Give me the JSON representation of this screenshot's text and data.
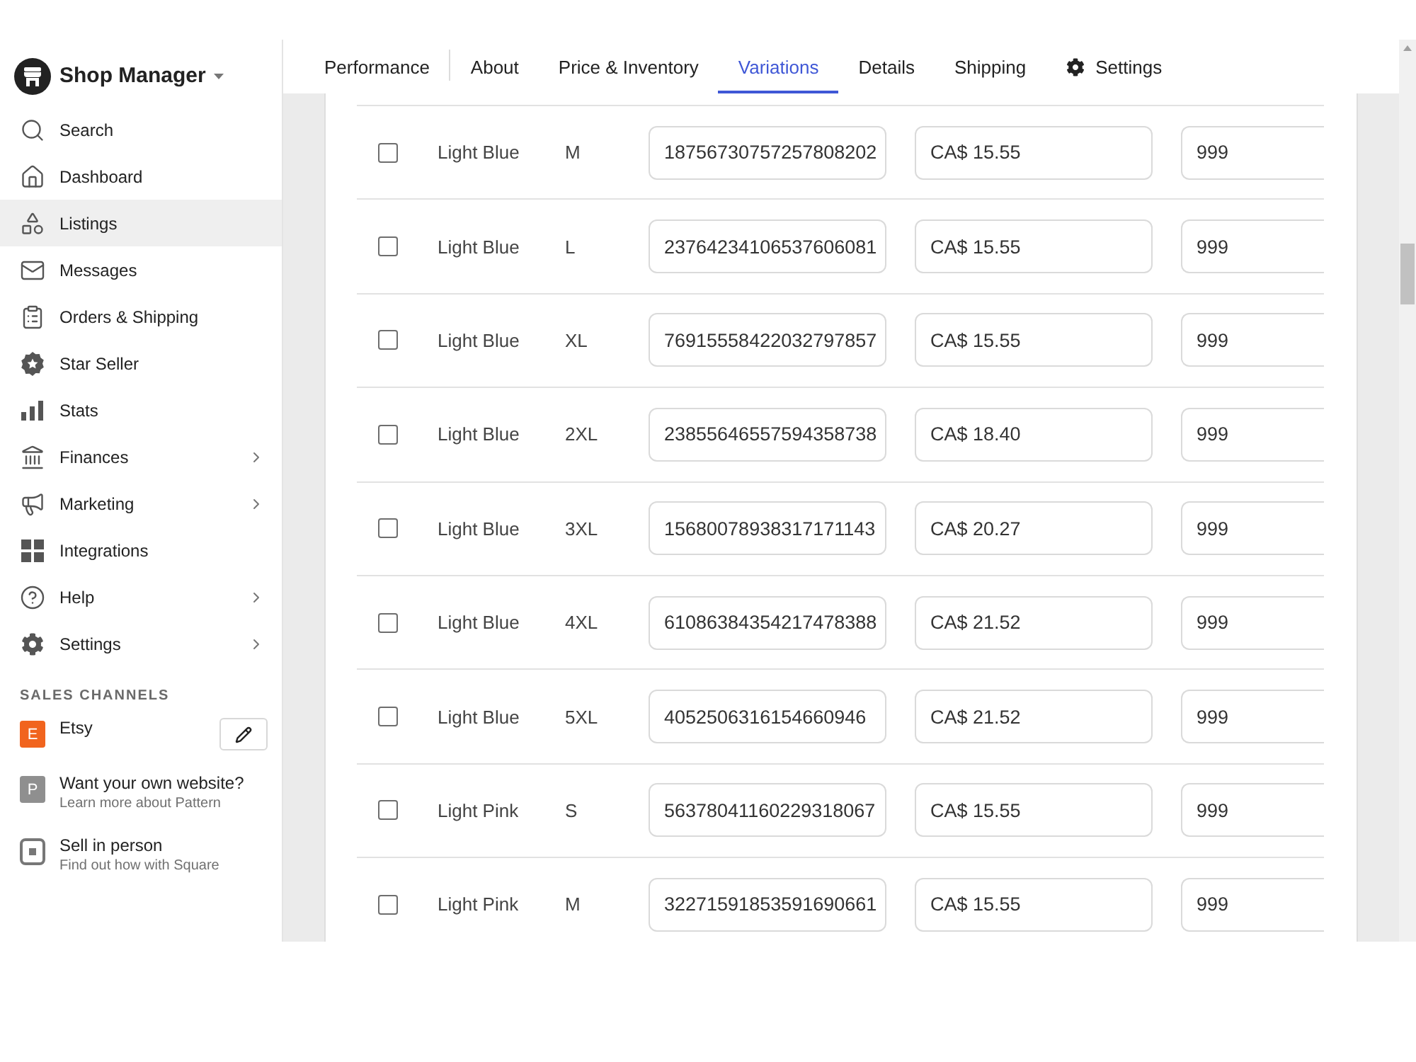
{
  "sidebar": {
    "title": "Shop Manager",
    "items": [
      {
        "label": "Search",
        "selected": false,
        "expandable": false
      },
      {
        "label": "Dashboard",
        "selected": false,
        "expandable": false
      },
      {
        "label": "Listings",
        "selected": true,
        "expandable": false
      },
      {
        "label": "Messages",
        "selected": false,
        "expandable": false
      },
      {
        "label": "Orders & Shipping",
        "selected": false,
        "expandable": false
      },
      {
        "label": "Star Seller",
        "selected": false,
        "expandable": false
      },
      {
        "label": "Stats",
        "selected": false,
        "expandable": false
      },
      {
        "label": "Finances",
        "selected": false,
        "expandable": true
      },
      {
        "label": "Marketing",
        "selected": false,
        "expandable": true
      },
      {
        "label": "Integrations",
        "selected": false,
        "expandable": false
      },
      {
        "label": "Help",
        "selected": false,
        "expandable": true
      },
      {
        "label": "Settings",
        "selected": false,
        "expandable": true
      }
    ],
    "section_title": "SALES CHANNELS",
    "channels": [
      {
        "kind": "badge",
        "badge": "E",
        "color": "#f1641e",
        "name": "Etsy",
        "editable": true
      },
      {
        "kind": "badge",
        "badge": "P",
        "color": "#8f8f8f",
        "name": "Want your own website?",
        "hint": "Learn more about Pattern"
      },
      {
        "kind": "icon",
        "name": "Sell in person",
        "hint": "Find out how with Square"
      }
    ]
  },
  "tabs": [
    {
      "kind": "text",
      "label": "Performance",
      "selected": false
    },
    {
      "kind": "text",
      "label": "About",
      "selected": false
    },
    {
      "kind": "text",
      "label": "Price & Inventory",
      "selected": false
    },
    {
      "kind": "text",
      "label": "Variations",
      "selected": true
    },
    {
      "kind": "text",
      "label": "Details",
      "selected": false
    },
    {
      "kind": "text",
      "label": "Shipping",
      "selected": false
    },
    {
      "kind": "settings",
      "label": "Settings",
      "selected": false
    }
  ],
  "variations": {
    "rows": [
      {
        "checked": false,
        "column_1": "Light Blue",
        "column_2": "M",
        "column_3": "18756730757257808202",
        "column_4": "CA$ 15.55",
        "column_5": "999"
      },
      {
        "checked": false,
        "column_1": "Light Blue",
        "column_2": "L",
        "column_3": "23764234106537606081",
        "column_4": "CA$ 15.55",
        "column_5": "999"
      },
      {
        "checked": false,
        "column_1": "Light Blue",
        "column_2": "XL",
        "column_3": "76915558422032797857",
        "column_4": "CA$ 15.55",
        "column_5": "999"
      },
      {
        "checked": false,
        "column_1": "Light Blue",
        "column_2": "2XL",
        "column_3": "23855646557594358738",
        "column_4": "CA$ 18.40",
        "column_5": "999"
      },
      {
        "checked": false,
        "column_1": "Light Blue",
        "column_2": "3XL",
        "column_3": "15680078938317171143",
        "column_4": "CA$ 20.27",
        "column_5": "999"
      },
      {
        "checked": false,
        "column_1": "Light Blue",
        "column_2": "4XL",
        "column_3": "61086384354217478388",
        "column_4": "CA$ 21.52",
        "column_5": "999"
      },
      {
        "checked": false,
        "column_1": "Light Blue",
        "column_2": "5XL",
        "column_3": "4052506316154660946",
        "column_4": "CA$ 21.52",
        "column_5": "999"
      },
      {
        "checked": false,
        "column_1": "Light Pink",
        "column_2": "S",
        "column_3": "56378041160229318067",
        "column_4": "CA$ 15.55",
        "column_5": "999"
      },
      {
        "checked": false,
        "column_1": "Light Pink",
        "column_2": "M",
        "column_3": "32271591853591690661",
        "column_4": "CA$ 15.55",
        "column_5": "999"
      }
    ]
  }
}
